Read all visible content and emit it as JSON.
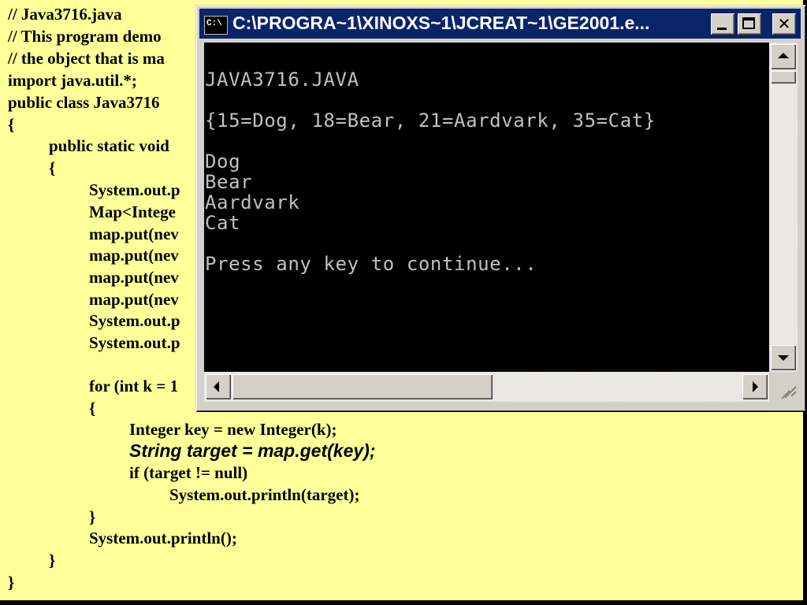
{
  "slide": {
    "code_lines": [
      "// Java3716.java",
      "// This program demo",
      "// the object that is ma",
      "import java.util.*;",
      "public class Java3716",
      "{",
      "public static void",
      "{",
      "System.out.p",
      "Map<Intege",
      "map.put(nev",
      "map.put(nev",
      "map.put(nev",
      "map.put(nev",
      "System.out.p",
      "System.out.p",
      "for (int k = 1",
      "{",
      "Integer key = new Integer(k);",
      "String target = map.get(key);",
      "if (target != null)",
      "System.out.println(target);",
      "}",
      "System.out.println();",
      "}",
      "}"
    ]
  },
  "window": {
    "title": "C:\\PROGRA~1\\XINOXS~1\\JCREAT~1\\GE2001.e...",
    "icon": "console-icon",
    "icon_text": "C:\\",
    "controls": [
      "minimize",
      "maximize",
      "close"
    ],
    "close_glyph": "✕",
    "console_output": [
      "JAVA3716.JAVA",
      "",
      "{15=Dog, 18=Bear, 21=Aardvark, 35=Cat}",
      "",
      "Dog",
      "Bear",
      "Aardvark",
      "Cat",
      "",
      "Press any key to continue..."
    ]
  },
  "colors": {
    "slide_background": "#FFFF99",
    "title_bar": "#0A246A",
    "console_background": "#000000",
    "console_text": "#C0C0C0"
  }
}
